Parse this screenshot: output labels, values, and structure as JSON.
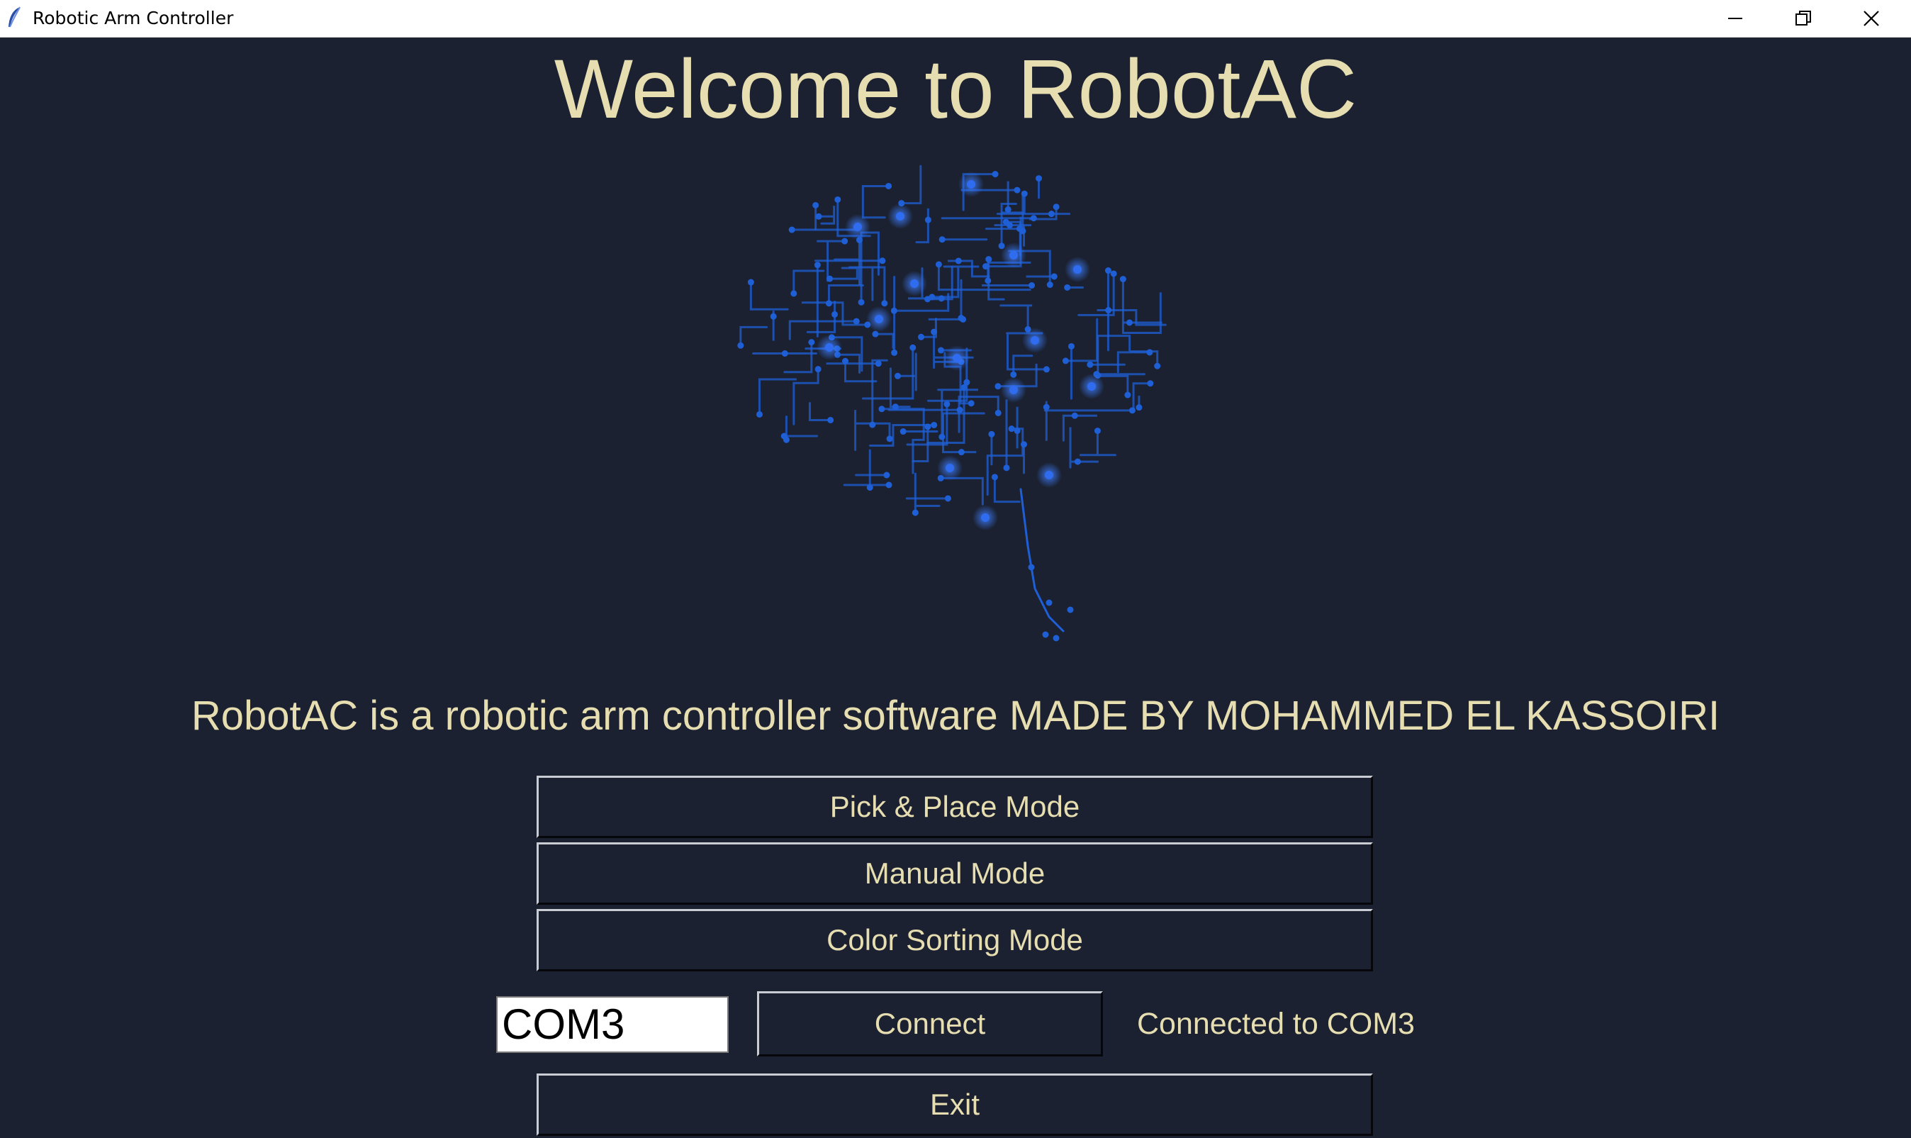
{
  "window": {
    "title": "Robotic Arm Controller",
    "controls": [
      "minimize-icon",
      "restore-icon",
      "close-icon"
    ]
  },
  "main": {
    "heading": "Welcome to RobotAC",
    "image": "circuit-brain",
    "subtitle": "RobotAC is a robotic arm controller software MADE BY MOHAMMED EL KASSOIRI"
  },
  "modes": {
    "pick_place_label": "Pick & Place Mode",
    "manual_label": "Manual Mode",
    "color_sorting_label": "Color Sorting Mode"
  },
  "connection": {
    "port_value": "COM3",
    "connect_label": "Connect",
    "status": "Connected to COM3"
  },
  "footer": {
    "exit_label": "Exit"
  },
  "colors": {
    "background": "#1b2130",
    "text": "#e6ddb0",
    "circuit": "#1f5fd6"
  }
}
